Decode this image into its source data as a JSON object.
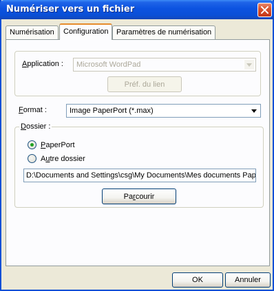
{
  "window": {
    "title": "Numériser vers un fichier"
  },
  "tabs": [
    {
      "label": "Numérisation"
    },
    {
      "label": "Configuration"
    },
    {
      "label": "Paramètres de numérisation"
    }
  ],
  "application": {
    "label_accel": "A",
    "label_rest": "pplication :",
    "value": "Microsoft WordPad",
    "link_button": "Préf. du lien"
  },
  "format": {
    "label_accel": "F",
    "label_rest": "ormat :",
    "value": "Image PaperPort (*.max)"
  },
  "folder": {
    "legend_accel": "D",
    "legend_rest": "ossier :",
    "option_paperport_accel": "P",
    "option_paperport_rest": "aperPort",
    "option_other_pre": "A",
    "option_other_accel": "u",
    "option_other_rest": "tre dossier",
    "path": "D:\\Documents and Settings\\csg\\My Documents\\Mes documents Paper",
    "browse_pre": "Pa",
    "browse_accel": "r",
    "browse_rest": "courir"
  },
  "footer": {
    "ok": "OK",
    "cancel": "Annuler"
  }
}
